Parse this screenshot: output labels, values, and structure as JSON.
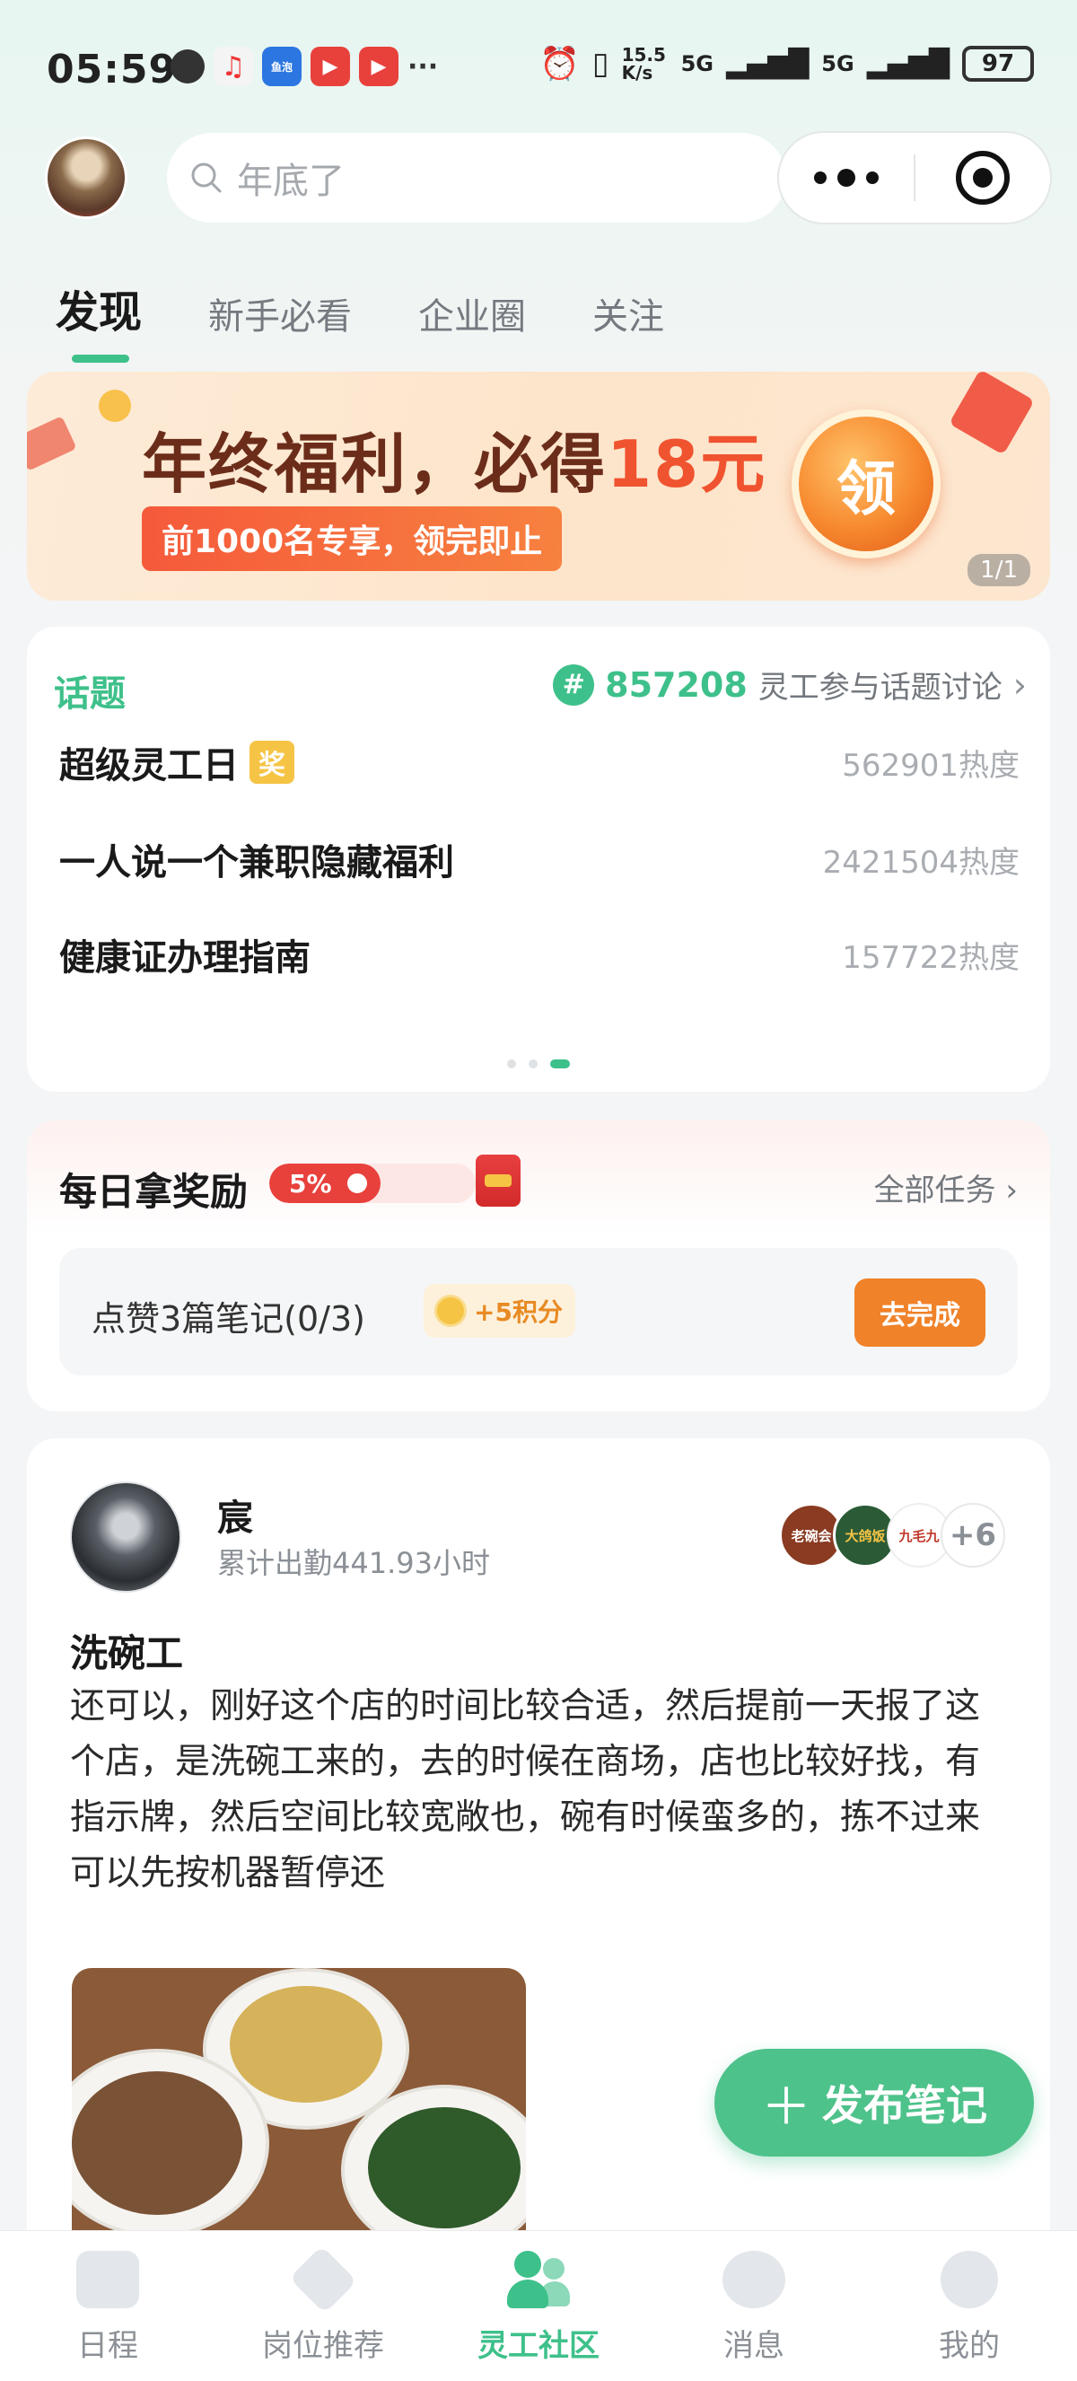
{
  "status_bar": {
    "time": "05:59",
    "network_speed": "15.5 K/s",
    "signal1": "5G",
    "signal2": "5G",
    "battery": "97"
  },
  "header": {
    "search_placeholder": "年底了"
  },
  "tabs": [
    {
      "label": "发现",
      "active": true
    },
    {
      "label": "新手必看",
      "active": false
    },
    {
      "label": "企业圈",
      "active": false
    },
    {
      "label": "关注",
      "active": false
    }
  ],
  "banner": {
    "title_prefix": "年终福利，必得",
    "title_amount": "18元",
    "subtitle": "前1000名专享，领完即止",
    "claim_label": "领",
    "page_indicator": "1/1"
  },
  "topics": {
    "label": "话题",
    "count": "857208",
    "description": "灵工参与话题讨论",
    "items": [
      {
        "name": "超级灵工日",
        "badge": "奖",
        "heat": "562901热度"
      },
      {
        "name": "一人说一个兼职隐藏福利",
        "badge": "",
        "heat": "2421504热度"
      },
      {
        "name": "健康证办理指南",
        "badge": "",
        "heat": "157722热度"
      }
    ],
    "pager": {
      "total": 3,
      "current": 3
    }
  },
  "daily_reward": {
    "title": "每日拿奖励",
    "progress_label": "5%",
    "progress_value": 0.05,
    "all_tasks": "全部任务",
    "task": {
      "text": "点赞3篇笔记(0/3)",
      "points": "+5积分",
      "button": "去完成"
    }
  },
  "post": {
    "author": "宸",
    "hours": "累计出勤441.93小时",
    "logos": [
      "老碗会",
      "大鸽饭",
      "九毛九"
    ],
    "logos_more": "+6",
    "title": "洗碗工",
    "body": "还可以，刚好这个店的时间比较合适，然后提前一天报了这个店，是洗碗工来的，去的时候在商场，店也比较好找，有指示牌，然后空间比较宽敞也，碗有时候蛮多的，拣不过来可以先按机器暂停还"
  },
  "fab": {
    "label": "发布笔记"
  },
  "tabbar": [
    {
      "label": "日程",
      "icon": "calendar-icon",
      "active": false
    },
    {
      "label": "岗位推荐",
      "icon": "layers-icon",
      "active": false
    },
    {
      "label": "灵工社区",
      "icon": "community-icon",
      "active": true
    },
    {
      "label": "消息",
      "icon": "message-icon",
      "active": false
    },
    {
      "label": "我的",
      "icon": "profile-icon",
      "active": false
    }
  ],
  "colors": {
    "accent": "#3ec08a",
    "orange": "#f08229",
    "red": "#e8413c"
  }
}
